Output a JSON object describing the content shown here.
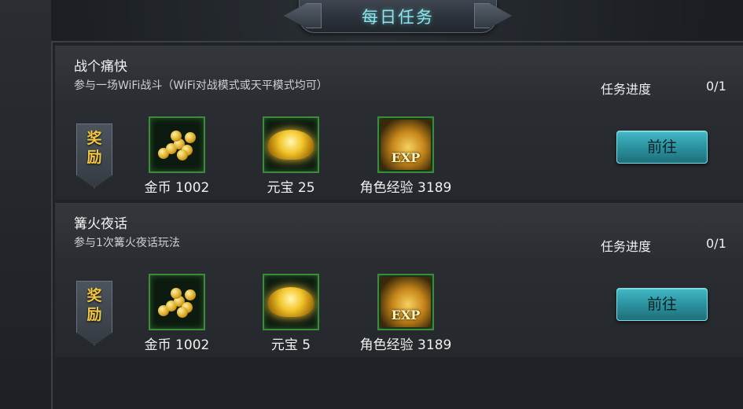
{
  "header": {
    "title": "每日任务"
  },
  "tasks": [
    {
      "title": "战个痛快",
      "description": "参与一场WiFi战斗（WiFi对战模式或天平模式均可）",
      "progress_label": "任务进度",
      "progress_value": "0/1",
      "reward_label_top": "奖",
      "reward_label_bottom": "励",
      "rewards": [
        {
          "icon": "gold-coins-icon",
          "label": "金币 1002"
        },
        {
          "icon": "gold-ingot-icon",
          "label": "元宝 25"
        },
        {
          "icon": "exp-icon",
          "label": "角色经验 3189",
          "icon_text": "EXP"
        }
      ],
      "button_label": "前往"
    },
    {
      "title": "篝火夜话",
      "description": "参与1次篝火夜话玩法",
      "progress_label": "任务进度",
      "progress_value": "0/1",
      "reward_label_top": "奖",
      "reward_label_bottom": "励",
      "rewards": [
        {
          "icon": "gold-coins-icon",
          "label": "金币 1002"
        },
        {
          "icon": "gold-ingot-icon",
          "label": "元宝 5"
        },
        {
          "icon": "exp-icon",
          "label": "角色经验 3189",
          "icon_text": "EXP"
        }
      ],
      "button_label": "前往"
    }
  ],
  "colors": {
    "title_cyan": "#8fe3ea",
    "reward_gold": "#f3c640",
    "button_teal": "#2a8f9c",
    "icon_border_green": "#3f8a3a"
  }
}
